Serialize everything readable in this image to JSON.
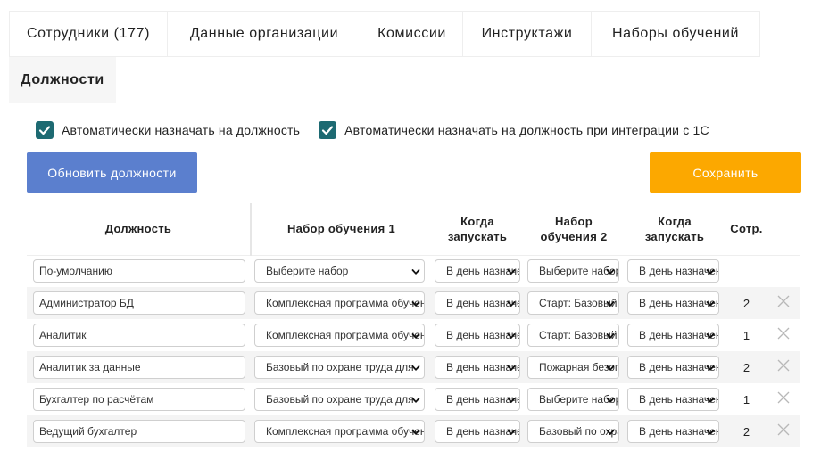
{
  "tabs": {
    "row1": [
      "Сотрудники (177)",
      "Данные организации",
      "Комиссии",
      "Инструктажи",
      "Наборы обучений"
    ],
    "row2": [
      "Должности"
    ],
    "active": "Должности"
  },
  "options": {
    "auto_assign": {
      "label": "Автоматически назначать на должность",
      "checked": true
    },
    "auto_assign_1c": {
      "label": "Автоматически назначать на должность при интеграции с 1С",
      "checked": true
    }
  },
  "buttons": {
    "refresh": "Обновить должности",
    "save": "Сохранить"
  },
  "table": {
    "headers": {
      "position": "Должность",
      "set1": "Набор обучения 1",
      "when1": "Когда запускать",
      "set2": "Набор обучения 2",
      "when2": "Когда запускать",
      "count": "Сотр."
    },
    "rows": [
      {
        "position": "По-умолчанию",
        "set1": "Выберите набор",
        "when1": "В день назначения",
        "set2": "Выберите набор",
        "when2": "В день назначения",
        "count": ""
      },
      {
        "position": "Администратор БД",
        "set1": "Комплексная программа обучения",
        "when1": "В день назначения",
        "set2": "Старт: Базовый",
        "when2": "В день назначения",
        "count": "2"
      },
      {
        "position": "Аналитик",
        "set1": "Комплексная программа обучения",
        "when1": "В день назначения",
        "set2": "Старт: Базовый",
        "when2": "В день назначения",
        "count": "1"
      },
      {
        "position": "Аналитик за данные",
        "set1": "Базовый по охране труда для",
        "when1": "В день назначения",
        "set2": "Пожарная безопасность",
        "when2": "В день назначения",
        "count": "2"
      },
      {
        "position": "Бухгалтер по расчётам",
        "set1": "Базовый по охране труда для",
        "when1": "В день назначения",
        "set2": "Выберите набор",
        "when2": "В день назначения",
        "count": "1"
      },
      {
        "position": "Ведущий бухгалтер",
        "set1": "Комплексная программа обучения",
        "when1": "В день назначения",
        "set2": "Базовый по охране",
        "when2": "В день назначения",
        "count": "2"
      }
    ]
  },
  "colors": {
    "checkbox": "#1d6a72",
    "refresh_button": "#5b7fce",
    "save_button": "#fca800"
  },
  "icons": {
    "check": "checkmark-icon",
    "select": "chevron-down-icon",
    "delete": "close-icon"
  }
}
